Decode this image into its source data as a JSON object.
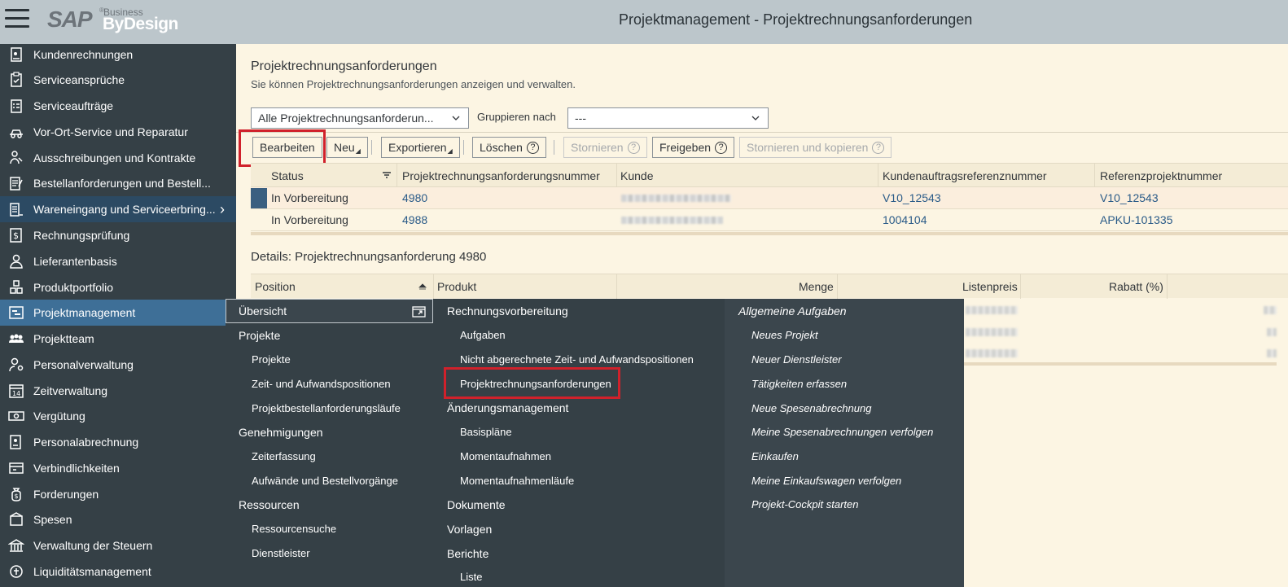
{
  "shell": {
    "title": "Projektmanagement - Projektrechnungsanforderungen",
    "logo_sap": "SAP",
    "logo_business": "Business",
    "logo_bydesign": "ByDesign"
  },
  "nav": {
    "items": [
      {
        "label": "Kundenrechnungen",
        "icon": "invoice-icon"
      },
      {
        "label": "Serviceansprüche",
        "icon": "clipboard-icon"
      },
      {
        "label": "Serviceaufträge",
        "icon": "checklist-icon"
      },
      {
        "label": "Vor-Ort-Service und Reparatur",
        "icon": "truck-icon"
      },
      {
        "label": "Ausschreibungen und Kontrakte",
        "icon": "handshake-icon"
      },
      {
        "label": "Bestellanforderungen und Bestell...",
        "icon": "order-icon"
      },
      {
        "label": "Wareneingang und Serviceerbring...",
        "icon": "receipt-icon"
      },
      {
        "label": "Rechnungsprüfung",
        "icon": "dollar-doc-icon"
      },
      {
        "label": "Lieferantenbasis",
        "icon": "supplier-icon"
      },
      {
        "label": "Produktportfolio",
        "icon": "cubes-icon"
      },
      {
        "label": "Projektmanagement",
        "icon": "project-icon"
      },
      {
        "label": "Projektteam",
        "icon": "team-icon"
      },
      {
        "label": "Personalverwaltung",
        "icon": "person-gear-icon"
      },
      {
        "label": "Zeitverwaltung",
        "icon": "calendar-icon"
      },
      {
        "label": "Vergütung",
        "icon": "money-icon"
      },
      {
        "label": "Personalabrechnung",
        "icon": "payroll-icon"
      },
      {
        "label": "Verbindlichkeiten",
        "icon": "payables-icon"
      },
      {
        "label": "Forderungen",
        "icon": "money-bag-icon"
      },
      {
        "label": "Spesen",
        "icon": "expense-icon"
      },
      {
        "label": "Verwaltung der Steuern",
        "icon": "tax-icon"
      },
      {
        "label": "Liquiditätsmanagement",
        "icon": "liquidity-icon"
      }
    ]
  },
  "page": {
    "title": "Projektrechnungsanforderungen",
    "subtitle": "Sie können Projektrechnungsanforderungen anzeigen und verwalten.",
    "query_select": "Alle Projektrechnungsanforderun...",
    "group_label": "Gruppieren nach",
    "group_select": "---"
  },
  "toolbar": {
    "edit": "Bearbeiten",
    "new": "Neu",
    "export": "Exportieren",
    "delete": "Löschen",
    "cancel": "Stornieren",
    "release": "Freigeben",
    "cancel_copy": "Stornieren und kopieren",
    "help_glyph": "?"
  },
  "table": {
    "columns": [
      "Status",
      "Projektrechnungsanforderungsnummer",
      "Kunde",
      "Kundenauftragsreferenznummer",
      "Referenzprojektnummer"
    ],
    "rows": [
      {
        "status": "In Vorbereitung",
        "number": "4980",
        "customer": "",
        "order_ref": "V10_12543",
        "project_ref": "V10_12543"
      },
      {
        "status": "In Vorbereitung",
        "number": "4988",
        "customer": "",
        "order_ref": "1004104",
        "project_ref": "APKU-101335"
      }
    ]
  },
  "details": {
    "title": "Details: Projektrechnungsanforderung 4980",
    "columns": [
      "Position",
      "Produkt",
      "Menge",
      "Listenpreis",
      "Rabatt (%)"
    ]
  },
  "flyout": {
    "col1": {
      "overview": "Übersicht",
      "projects_head": "Projekte",
      "projects": [
        "Projekte",
        "Zeit- und Aufwandspositionen",
        "Projektbestellanforderungsläufe"
      ],
      "approvals_head": "Genehmigungen",
      "approvals": [
        "Zeiterfassung",
        "Aufwände und Bestellvorgänge"
      ],
      "resources_head": "Ressourcen",
      "resources": [
        "Ressourcensuche",
        "Dienstleister"
      ]
    },
    "col2": {
      "billing_head": "Rechnungsvorbereitung",
      "billing": [
        "Aufgaben",
        "Nicht abgerechnete Zeit- und Aufwandspositionen",
        "Projektrechnungsanforderungen"
      ],
      "change_head": "Änderungsmanagement",
      "change": [
        "Basispläne",
        "Momentaufnahmen",
        "Momentaufnahmenläufe"
      ],
      "documents": "Dokumente",
      "templates": "Vorlagen",
      "reports_head": "Berichte",
      "reports": [
        "Liste"
      ]
    },
    "col3": {
      "head": "Allgemeine Aufgaben",
      "items": [
        "Neues Projekt",
        "Neuer Dienstleister",
        "Tätigkeiten erfassen",
        "Neue Spesenabrechnung",
        "Meine Spesenabrechnungen verfolgen",
        "Einkaufen",
        "Meine Einkaufswagen verfolgen",
        "Projekt-Cockpit starten"
      ]
    }
  },
  "colors": {
    "shell": "#bcc6cb",
    "nav_bg": "#354046",
    "nav_selected": "#3e6f97",
    "content_bg": "#fcf5e3",
    "link": "#2a5b88",
    "highlight": "#d0212b"
  }
}
